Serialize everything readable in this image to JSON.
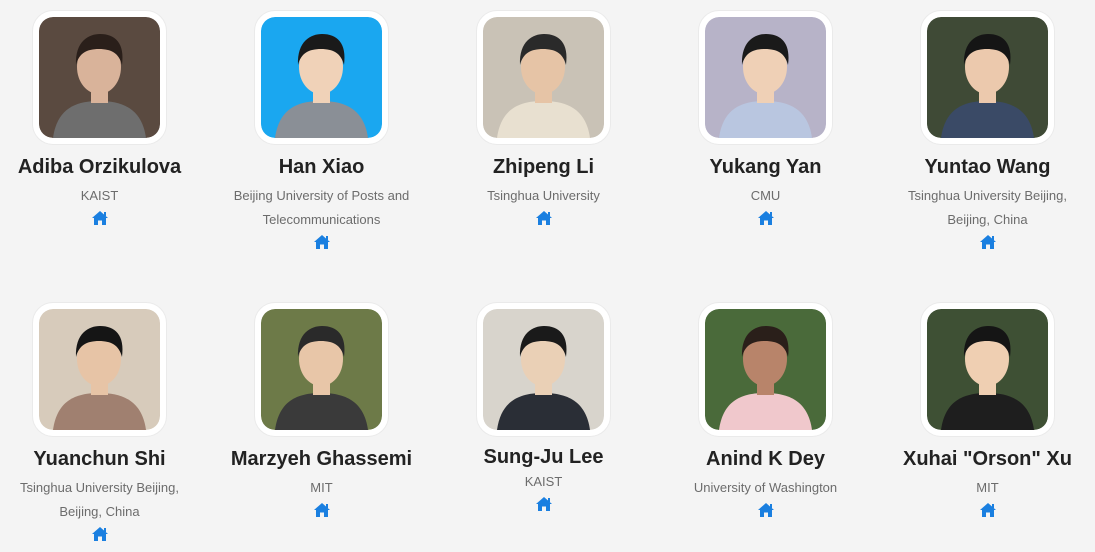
{
  "accent_color": "#1a7fe0",
  "people": [
    {
      "name": "Adiba Orzikulova",
      "affiliation": "KAIST",
      "link_icon": "home-icon",
      "photo_bg": "#5a4a40",
      "skin": "#d9b39a",
      "hair": "#2a1f1a",
      "shirt": "#6e6e6e"
    },
    {
      "name": "Han Xiao",
      "affiliation": "Beijing University of Posts and Telecommunications",
      "link_icon": "home-icon",
      "photo_bg": "#1aa7f0",
      "skin": "#f0d2b8",
      "hair": "#1a1a1a",
      "shirt": "#8a8f96"
    },
    {
      "name": "Zhipeng Li",
      "affiliation": "Tsinghua University",
      "link_icon": "home-icon",
      "photo_bg": "#c9c2b6",
      "skin": "#e6c4a6",
      "hair": "#2a2a2a",
      "shirt": "#e8e0d0"
    },
    {
      "name": "Yukang Yan",
      "affiliation": "CMU",
      "link_icon": "home-icon",
      "photo_bg": "#b7b3c8",
      "skin": "#efd0b6",
      "hair": "#1a1a1a",
      "shirt": "#b9c6e0"
    },
    {
      "name": "Yuntao Wang",
      "affiliation": "Tsinghua University Beijing, Beijing, China",
      "link_icon": "home-icon",
      "photo_bg": "#3f4a36",
      "skin": "#ecc9ad",
      "hair": "#151515",
      "shirt": "#3a4a66"
    },
    {
      "name": "Yuanchun Shi",
      "affiliation": "Tsinghua University Beijing, Beijing, China",
      "link_icon": "home-icon",
      "photo_bg": "#d7cbbb",
      "skin": "#e7c4a6",
      "hair": "#151515",
      "shirt": "#a08070"
    },
    {
      "name": "Marzyeh Ghassemi",
      "affiliation": "MIT",
      "link_icon": "home-icon",
      "photo_bg": "#6d7a48",
      "skin": "#e8c6a8",
      "hair": "#2a2a2a",
      "shirt": "#3a3a3a"
    },
    {
      "name": "Sung-Ju Lee",
      "affiliation": "KAIST",
      "link_icon": "home-icon",
      "photo_bg": "#d8d4cc",
      "skin": "#ead0b6",
      "hair": "#1a1a1a",
      "shirt": "#2a2e36"
    },
    {
      "name": "Anind K Dey",
      "affiliation": "University of Washington",
      "link_icon": "home-icon",
      "photo_bg": "#4a6a3a",
      "skin": "#b8846a",
      "hair": "#2a1f1a",
      "shirt": "#f0c8cc"
    },
    {
      "name": "Xuhai \"Orson\" Xu",
      "affiliation": "MIT",
      "link_icon": "home-icon",
      "photo_bg": "#3e5034",
      "skin": "#efcfb2",
      "hair": "#151515",
      "shirt": "#1e1e1e"
    }
  ]
}
